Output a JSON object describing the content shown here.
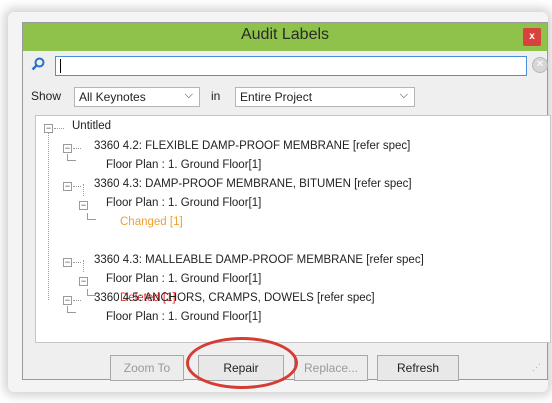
{
  "dialog": {
    "title": "Audit Labels",
    "close_label": "x",
    "search": {
      "value": "",
      "placeholder": ""
    },
    "show_label": "Show",
    "show_value": "All Keynotes",
    "in_label": "in",
    "scope_value": "Entire Project"
  },
  "tree": {
    "root": "Untitled",
    "items": [
      {
        "label": "3360 4.2: FLEXIBLE DAMP-PROOF MEMBRANE [refer spec]",
        "child": "Floor Plan : 1. Ground Floor[1]"
      },
      {
        "label": "3360 4.3: DAMP-PROOF MEMBRANE, BITUMEN [refer spec]",
        "child": "Floor Plan : 1. Ground Floor[1]",
        "status": "Changed [1]"
      },
      {
        "label": "3360 4.3: MALLEABLE DAMP-PROOF MEMBRANE [refer spec]",
        "child": "Floor Plan : 1. Ground Floor[1]",
        "status": "Deleted [1]"
      },
      {
        "label": "3360 4.5: ANCHORS, CRAMPS, DOWELS [refer spec]",
        "child": "Floor Plan : 1. Ground Floor[1]"
      }
    ]
  },
  "buttons": {
    "zoom_to": "Zoom To",
    "repair": "Repair",
    "replace": "Replace...",
    "refresh": "Refresh"
  },
  "colors": {
    "titlebar": "#8fc24a",
    "close": "#d9423c",
    "changed": "#f0a030",
    "deleted": "#e03030",
    "highlight_circle": "#d63c33"
  }
}
